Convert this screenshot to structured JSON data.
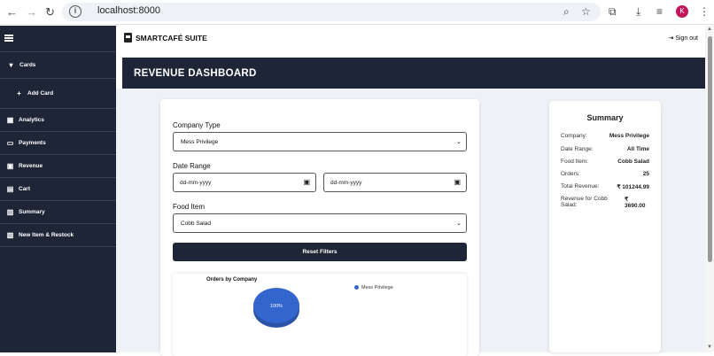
{
  "browser": {
    "url": "localhost:8000",
    "avatar": "K"
  },
  "app": {
    "brand": "SMARTCAFÉ SUITE",
    "signout": "Sign out",
    "page_title": "REVENUE DASHBOARD"
  },
  "sidebar": {
    "cards": "Cards",
    "add_card": "Add Card",
    "items": [
      "Analytics",
      "Payments",
      "Revenue",
      "Cart",
      "Summary",
      "New Item & Restock"
    ]
  },
  "filters": {
    "company_label": "Company Type",
    "company_value": "Mess Privilege",
    "date_label": "Date Range",
    "date_from_placeholder": "dd-mm-yyyy",
    "date_to_placeholder": "dd-mm-yyyy",
    "food_label": "Food Item",
    "food_value": "Cobb Salad",
    "reset": "Reset Filters"
  },
  "chart_data": {
    "type": "pie",
    "title": "Orders by Company",
    "categories": [
      "Mess Privilege"
    ],
    "values": [
      100
    ],
    "labels": [
      "100%"
    ],
    "colors": [
      "#3366cc"
    ],
    "legend_position": "top-right"
  },
  "summary": {
    "title": "Summary",
    "rows": [
      {
        "label": "Company:",
        "value": "Mess Privilege"
      },
      {
        "label": "Date Range:",
        "value": "All Time"
      },
      {
        "label": "Food Item:",
        "value": "Cobb Salad"
      },
      {
        "label": "Orders:",
        "value": "25"
      },
      {
        "label": "Total Revenue:",
        "value": "₹ 101244.99"
      },
      {
        "label": "Revenue for Cobb Salad:",
        "value": "₹ 3690.00"
      }
    ]
  }
}
